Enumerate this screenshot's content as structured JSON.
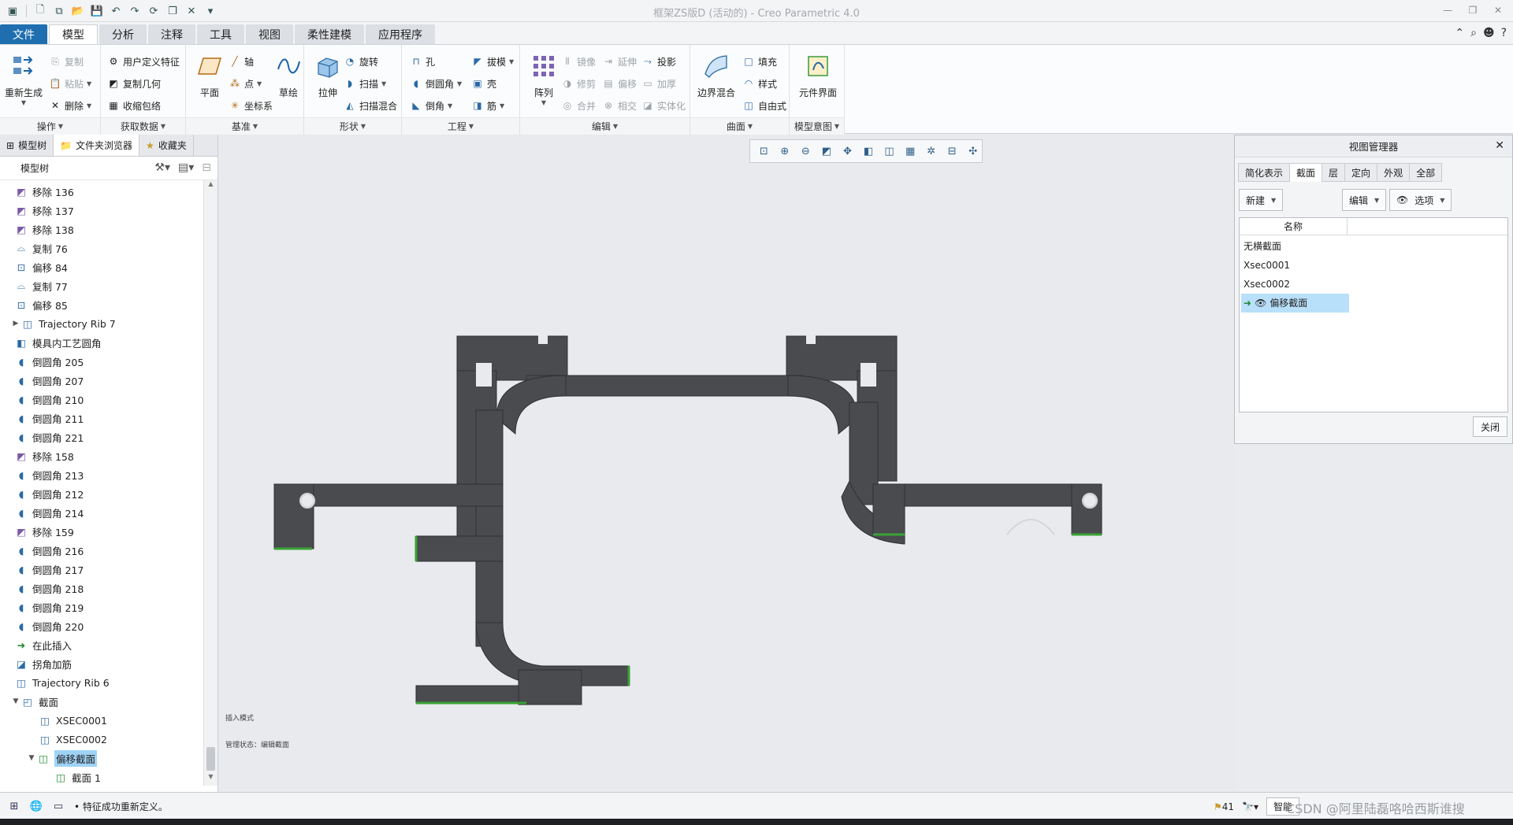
{
  "app": {
    "title": "框架ZS版D (活动的) - Creo Parametric 4.0"
  },
  "ribbon": {
    "tabs": [
      {
        "label": "文件"
      },
      {
        "label": "模型"
      },
      {
        "label": "分析"
      },
      {
        "label": "注释"
      },
      {
        "label": "工具"
      },
      {
        "label": "视图"
      },
      {
        "label": "柔性建模"
      },
      {
        "label": "应用程序"
      }
    ],
    "groups": {
      "operations": {
        "label": "操作",
        "regenerate": "重新生成",
        "copy": "复制",
        "paste": "粘贴",
        "delete": "删除"
      },
      "get_data": {
        "label": "获取数据",
        "udf": "用户定义特征",
        "copy_geom": "复制几何",
        "shrinkwrap": "收缩包络"
      },
      "datum": {
        "label": "基准",
        "plane": "平面",
        "axis": "轴",
        "point": "点",
        "csys": "坐标系",
        "sketch": "草绘"
      },
      "shapes": {
        "label": "形状",
        "extrude": "拉伸",
        "revolve": "旋转",
        "sweep": "扫描",
        "swept_blend": "扫描混合"
      },
      "engineering": {
        "label": "工程",
        "hole": "孔",
        "round": "倒圆角",
        "chamfer": "倒角",
        "draft": "拔模",
        "shell": "壳",
        "rib": "筋"
      },
      "editing": {
        "label": "编辑",
        "pattern": "阵列",
        "mirror": "镜像",
        "extend": "延伸",
        "project": "投影",
        "trim": "修剪",
        "offset": "偏移",
        "thicken": "加厚",
        "merge": "合并",
        "intersect": "相交",
        "solidify": "实体化"
      },
      "surfaces": {
        "label": "曲面",
        "boundary_blend": "边界混合",
        "fill": "填充",
        "style": "样式",
        "freestyle": "自由式"
      },
      "model_intent": {
        "label": "模型意图",
        "component_interface": "元件界面"
      }
    }
  },
  "left_panel": {
    "tabs": [
      {
        "label": "模型树"
      },
      {
        "label": "文件夹浏览器"
      },
      {
        "label": "收藏夹"
      }
    ],
    "tree_title": "模型树",
    "items": [
      {
        "label": "移除 136"
      },
      {
        "label": "移除 137"
      },
      {
        "label": "移除 138"
      },
      {
        "label": "复制 76"
      },
      {
        "label": "偏移 84"
      },
      {
        "label": "复制 77"
      },
      {
        "label": "偏移 85"
      },
      {
        "label": "Trajectory Rib 7"
      },
      {
        "label": "模具内工艺圆角"
      },
      {
        "label": "倒圆角 205"
      },
      {
        "label": "倒圆角 207"
      },
      {
        "label": "倒圆角 210"
      },
      {
        "label": "倒圆角 211"
      },
      {
        "label": "倒圆角 221"
      },
      {
        "label": "移除 158"
      },
      {
        "label": "倒圆角 213"
      },
      {
        "label": "倒圆角 212"
      },
      {
        "label": "倒圆角 214"
      },
      {
        "label": "移除 159"
      },
      {
        "label": "倒圆角 216"
      },
      {
        "label": "倒圆角 217"
      },
      {
        "label": "倒圆角 218"
      },
      {
        "label": "倒圆角 219"
      },
      {
        "label": "倒圆角 220"
      },
      {
        "label": "在此插入"
      },
      {
        "label": "拐角加筋"
      },
      {
        "label": "Trajectory Rib 6"
      },
      {
        "label": "截面"
      },
      {
        "label": "XSEC0001"
      },
      {
        "label": "XSEC0002"
      },
      {
        "label": "偏移截面"
      },
      {
        "label": "截面 1"
      }
    ]
  },
  "graphics": {
    "note1": "插入模式",
    "note2": "管理状态：编辑截面"
  },
  "view_manager": {
    "title": "视图管理器",
    "tabs": [
      {
        "label": "简化表示"
      },
      {
        "label": "截面"
      },
      {
        "label": "层"
      },
      {
        "label": "定向"
      },
      {
        "label": "外观"
      },
      {
        "label": "全部"
      }
    ],
    "new_label": "新建",
    "edit_label": "编辑",
    "options_label": "选项",
    "column_name": "名称",
    "rows": [
      {
        "label": "无横截面"
      },
      {
        "label": "Xsec0001"
      },
      {
        "label": "Xsec0002"
      },
      {
        "label": "偏移截面"
      }
    ],
    "close_label": "关闭"
  },
  "status": {
    "message": "• 特征成功重新定义。",
    "filter_label": "智能",
    "count": "41"
  },
  "watermark": "CSDN @阿里陆磊咯哈西斯谁搜",
  "colors": {
    "accent": "#1f6fb0",
    "selection": "#9fd3f5",
    "part": "#4a4b4e",
    "section_edge": "#39a335"
  }
}
